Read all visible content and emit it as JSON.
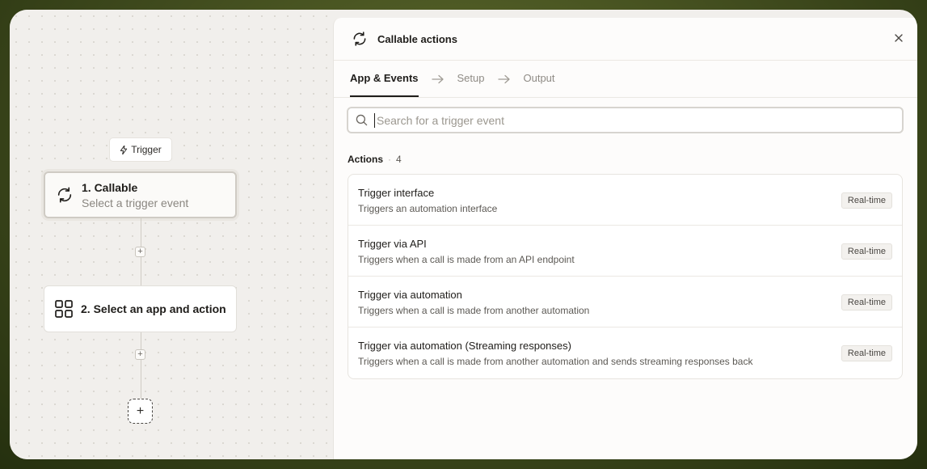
{
  "canvas": {
    "trigger_label": "Trigger",
    "step1": {
      "title": "1. Callable",
      "subtitle": "Select a trigger event"
    },
    "step2": {
      "title": "2. Select an app and action"
    },
    "add_step_small": "+",
    "add_step_big": "+"
  },
  "panel": {
    "title": "Callable actions",
    "tabs": [
      {
        "label": "App & Events",
        "active": true
      },
      {
        "label": "Setup",
        "active": false
      },
      {
        "label": "Output",
        "active": false
      }
    ],
    "search": {
      "placeholder": "Search for a trigger event",
      "value": ""
    },
    "actions_label": "Actions",
    "actions_count": "4",
    "actions": [
      {
        "title": "Trigger interface",
        "description": "Triggers an automation interface",
        "badge": "Real-time"
      },
      {
        "title": "Trigger via API",
        "description": "Triggers when a call is made from an API endpoint",
        "badge": "Real-time"
      },
      {
        "title": "Trigger via automation",
        "description": "Triggers when a call is made from another automation",
        "badge": "Real-time"
      },
      {
        "title": "Trigger via automation (Streaming responses)",
        "description": "Triggers when a call is made from another automation and sends streaming responses back",
        "badge": "Real-time"
      }
    ]
  },
  "icons": {
    "callable": "refresh-icon",
    "trigger": "lightning-icon",
    "app": "grid-icon",
    "close": "close-icon",
    "search": "search-icon",
    "arrow": "arrow-right-icon"
  },
  "colors": {
    "background_outer": "#4a5622",
    "canvas_bg": "#f1efec",
    "panel_bg": "#fdfcfb",
    "text_primary": "#1f1d1a",
    "text_muted": "#8f8b85"
  }
}
